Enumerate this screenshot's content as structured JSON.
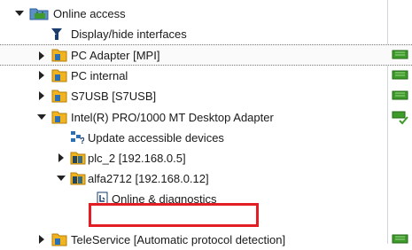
{
  "tree": {
    "root": {
      "label": "Online access"
    },
    "display_hide": {
      "label": "Display/hide interfaces"
    },
    "items": [
      {
        "label": "PC Adapter [MPI]"
      },
      {
        "label": "PC internal"
      },
      {
        "label": "S7USB [S7USB]"
      },
      {
        "label": "Intel(R) PRO/1000 MT Desktop Adapter"
      }
    ],
    "update_devices": {
      "label": "Update accessible devices"
    },
    "plc_2": {
      "label": "plc_2 [192.168.0.5]"
    },
    "alfa": {
      "label": "alfa2712 [192.168.0.12]"
    },
    "online_diag": {
      "label": "Online & diagnostics"
    },
    "teleservice": {
      "label": "TeleService [Automatic protocol detection]"
    }
  },
  "colors": {
    "folder": "#f2b321",
    "network_green": "#3d9a2b",
    "highlight_border": "#e21d24"
  }
}
